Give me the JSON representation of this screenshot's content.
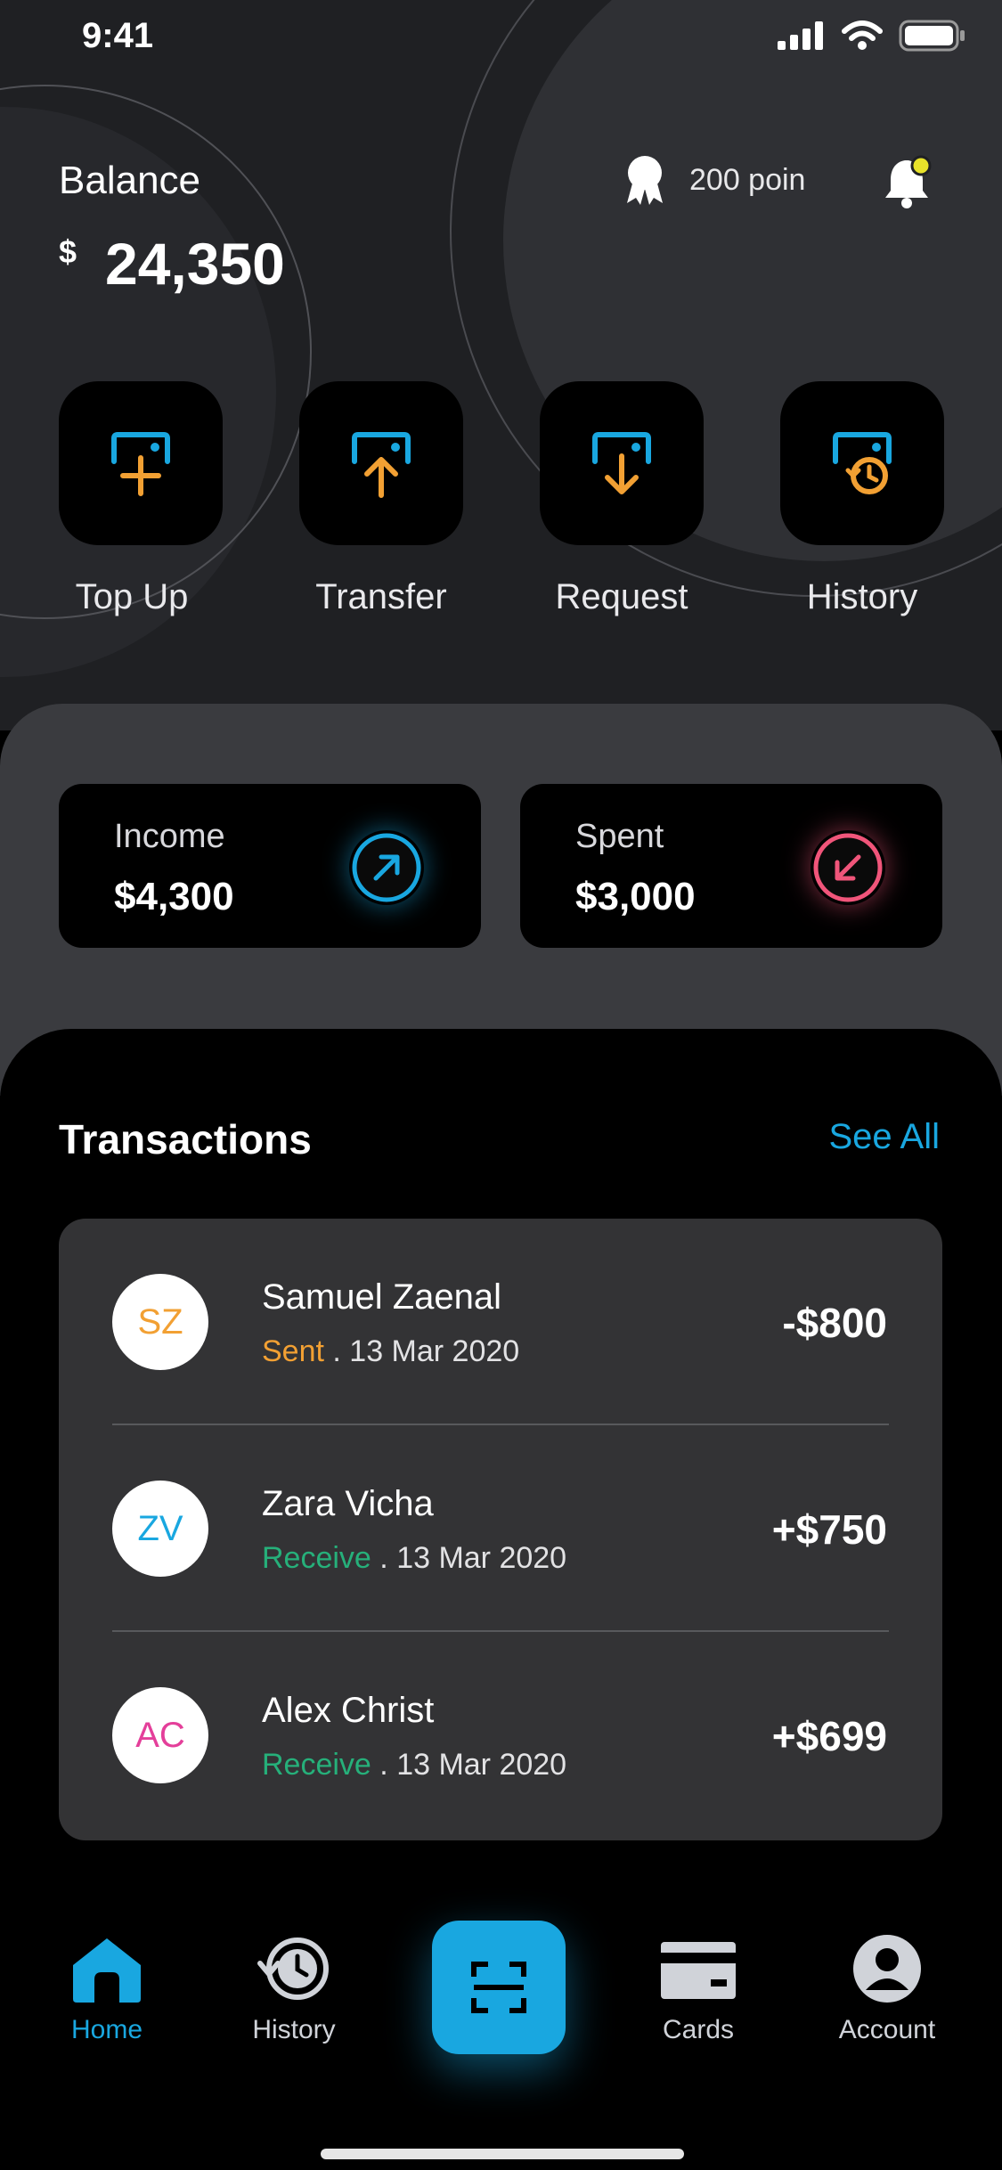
{
  "status": {
    "time": "9:41"
  },
  "balance": {
    "label": "Balance",
    "currency": "$",
    "amount": "24,350"
  },
  "points": {
    "text": "200 poin"
  },
  "actions": [
    {
      "label": "Top Up",
      "icon": "top-up-icon"
    },
    {
      "label": "Transfer",
      "icon": "transfer-icon"
    },
    {
      "label": "Request",
      "icon": "request-icon"
    },
    {
      "label": "History",
      "icon": "history-icon"
    }
  ],
  "stats": {
    "income": {
      "label": "Income",
      "value": "$4,300",
      "color": "#19a7e0"
    },
    "spent": {
      "label": "Spent",
      "value": "$3,000",
      "color": "#f0557a"
    }
  },
  "transactions": {
    "title": "Transactions",
    "see_all": "See All",
    "items": [
      {
        "initials": "SZ",
        "initials_color": "#f2a033",
        "name": "Samuel Zaenal",
        "type": "Sent",
        "type_color": "#f2a033",
        "sep": " . ",
        "date": "13 Mar 2020",
        "amount": "-$800"
      },
      {
        "initials": "ZV",
        "initials_color": "#19a7e0",
        "name": "Zara Vicha",
        "type": "Receive",
        "type_color": "#26b07a",
        "sep": " . ",
        "date": "13 Mar 2020",
        "amount": "+$750"
      },
      {
        "initials": "AC",
        "initials_color": "#e43f9a",
        "name": "Alex Christ",
        "type": "Receive",
        "type_color": "#26b07a",
        "sep": " . ",
        "date": "13 Mar 2020",
        "amount": "+$699"
      }
    ]
  },
  "nav": {
    "home": "Home",
    "history": "History",
    "cards": "Cards",
    "account": "Account",
    "active_color": "#19a7e0"
  }
}
